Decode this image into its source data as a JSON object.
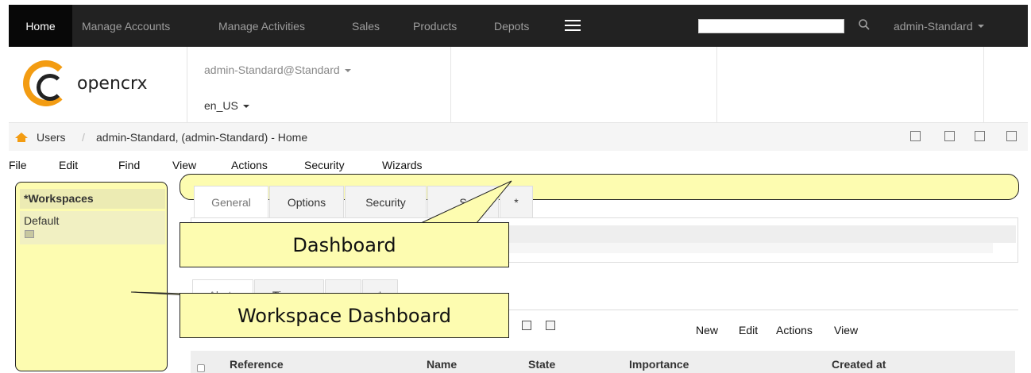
{
  "navbar": {
    "home": "Home",
    "links": [
      "Manage Accounts",
      "Manage Activities",
      "Sales",
      "Products",
      "Depots"
    ],
    "search_value": "",
    "user": "admin-Standard"
  },
  "header": {
    "logo_text": "opencrx",
    "user_segment": "admin-Standard@Standard",
    "locale": "en_US"
  },
  "breadcrumb": {
    "parent": "Users",
    "separator": "/",
    "current": "admin-Standard, (admin-Standard) - Home"
  },
  "menu": [
    "File",
    "Edit",
    "Find",
    "View",
    "Actions",
    "Security",
    "Wizards"
  ],
  "workspaces": {
    "header": "*Workspaces",
    "items": [
      "Default"
    ]
  },
  "tabs_top": [
    "General",
    "Options",
    "Security",
    "S",
    "*"
  ],
  "tabs_bottom": [
    "Alerts",
    "Timers",
    "",
    "*"
  ],
  "callouts": {
    "dashboard": "Dashboard",
    "workspace_dashboard": "Workspace Dashboard"
  },
  "grid_toolbar": {
    "actions": [
      "New",
      "Edit",
      "Actions",
      "View"
    ]
  },
  "table": {
    "columns": [
      "Reference",
      "Name",
      "State",
      "Importance",
      "Created at"
    ]
  },
  "colors": {
    "navbar_bg": "#222222",
    "callout_bg": "#fdfcb0",
    "logo_orange": "#f39c12"
  }
}
